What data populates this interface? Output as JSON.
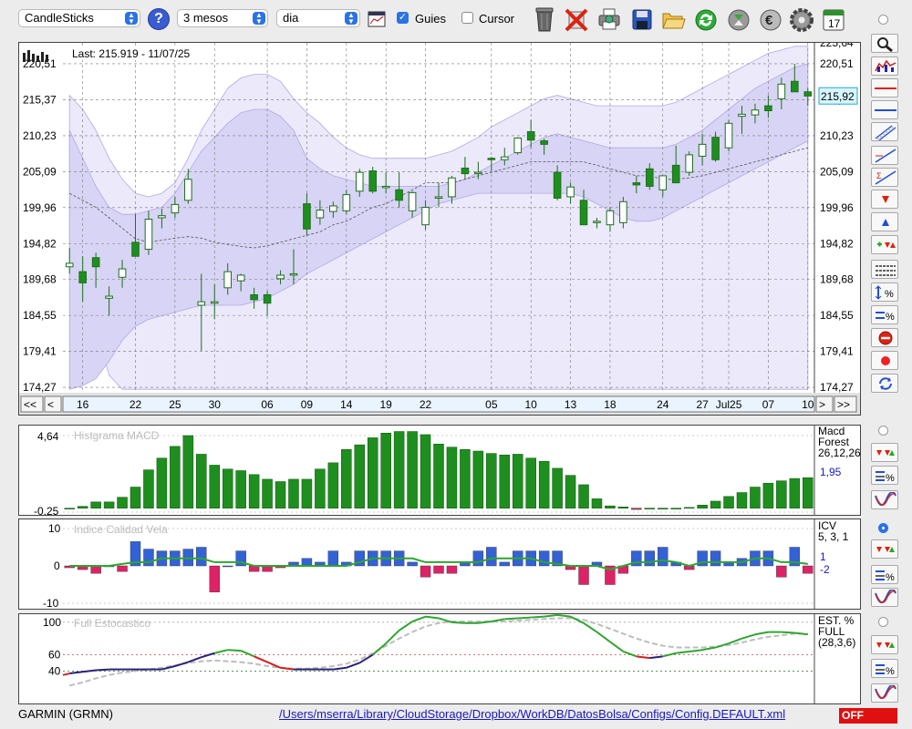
{
  "toolbar": {
    "chart_type": "CandleSticks",
    "period": "3 mesos",
    "interval": "dia",
    "guides_label": "Guies",
    "guides_checked": true,
    "cursor_label": "Cursor",
    "cursor_checked": false,
    "help_icon": "?",
    "icons": [
      "trash-icon",
      "delete-icon",
      "printer-icon",
      "save-icon",
      "open-folder-icon",
      "refresh-icon",
      "alert-icon",
      "euro-icon",
      "gear-icon",
      "calendar-icon"
    ]
  },
  "calendar_day": "17",
  "nav": {
    "first": "<<",
    "prev": "<",
    "next": ">",
    "last": ">>"
  },
  "colors": {
    "up": "#ffffff",
    "down": "#1e8f1e",
    "band": "#d8d4f5",
    "band_line": "#b1a8e6",
    "macd_bar": "#1e8f1e",
    "icv_up": "#3361d6",
    "icv_down": "#dd2266",
    "icv_line": "#2fa52f",
    "stoch_green": "#2fa52f",
    "stoch_navy": "#2b2077",
    "stoch_red": "#d02020",
    "stoch_gray": "#bdbdbd"
  },
  "chart_data": [
    {
      "type": "candlestick",
      "annotation": "Last: 215.919 - 11/07/25",
      "last_value_label": "215,92",
      "ylim": [
        173.5,
        223.5
      ],
      "yticks": [
        "174,27",
        "179,41",
        "184,55",
        "189,68",
        "194,82",
        "199,96",
        "205,09",
        "210,23",
        "215,37",
        "220,51",
        "225,64"
      ],
      "xticks": [
        {
          "i": 1,
          "label": "16"
        },
        {
          "i": 5,
          "label": "22"
        },
        {
          "i": 8,
          "label": "25"
        },
        {
          "i": 11,
          "label": "30"
        },
        {
          "i": 15,
          "label": "06"
        },
        {
          "i": 18,
          "label": "09"
        },
        {
          "i": 21,
          "label": "14"
        },
        {
          "i": 24,
          "label": "19"
        },
        {
          "i": 27,
          "label": "22"
        },
        {
          "i": 32,
          "label": "05"
        },
        {
          "i": 35,
          "label": "10"
        },
        {
          "i": 38,
          "label": "13"
        },
        {
          "i": 41,
          "label": "18"
        },
        {
          "i": 45,
          "label": "24"
        },
        {
          "i": 48,
          "label": "27"
        },
        {
          "i": 50,
          "label": "Jul25"
        },
        {
          "i": 53,
          "label": "07"
        },
        {
          "i": 56,
          "label": "10"
        }
      ],
      "candles": [
        [
          191.5,
          194.2,
          190.5,
          192.0
        ],
        [
          190.8,
          193.0,
          186.5,
          189.2
        ],
        [
          192.8,
          193.5,
          188.5,
          191.5
        ],
        [
          187.0,
          188.7,
          184.5,
          187.3
        ],
        [
          190.0,
          192.5,
          188.5,
          191.2
        ],
        [
          195.0,
          199.0,
          193.0,
          193.0
        ],
        [
          194.0,
          199.5,
          193.2,
          198.3
        ],
        [
          198.5,
          199.8,
          197.0,
          198.8
        ],
        [
          199.2,
          201.5,
          198.5,
          200.4
        ],
        [
          201.0,
          205.5,
          200.5,
          204.0
        ],
        [
          186.0,
          190.5,
          179.5,
          186.5
        ],
        [
          186.3,
          189.0,
          184.0,
          186.5
        ],
        [
          188.5,
          192.0,
          187.5,
          190.8
        ],
        [
          189.5,
          190.5,
          188.0,
          190.3
        ],
        [
          187.5,
          188.5,
          185.5,
          186.8
        ],
        [
          187.5,
          188.0,
          184.5,
          186.3
        ],
        [
          189.8,
          191.0,
          189.0,
          190.3
        ],
        [
          190.5,
          194.0,
          189.0,
          190.5
        ],
        [
          200.5,
          202.0,
          196.0,
          196.9
        ],
        [
          198.5,
          201.0,
          197.5,
          199.6
        ],
        [
          199.4,
          200.8,
          198.5,
          200.2
        ],
        [
          199.5,
          202.5,
          199.0,
          201.8
        ],
        [
          202.3,
          205.5,
          201.5,
          205.0
        ],
        [
          205.2,
          205.8,
          202.0,
          202.3
        ],
        [
          203.0,
          205.0,
          202.0,
          203.0
        ],
        [
          202.5,
          205.0,
          200.0,
          201.0
        ],
        [
          199.5,
          202.3,
          198.5,
          202.1
        ],
        [
          197.5,
          201.0,
          196.8,
          200.0
        ],
        [
          201.5,
          203.5,
          200.0,
          201.5
        ],
        [
          201.5,
          204.5,
          200.5,
          204.2
        ],
        [
          205.6,
          207.2,
          204.0,
          204.8
        ],
        [
          205.0,
          206.5,
          204.0,
          205.0
        ],
        [
          207.0,
          207.2,
          205.2,
          206.9
        ],
        [
          206.8,
          208.5,
          206.0,
          207.2
        ],
        [
          207.8,
          210.0,
          207.5,
          209.9
        ],
        [
          210.8,
          212.5,
          208.5,
          209.6
        ],
        [
          209.5,
          209.8,
          207.5,
          209.0
        ],
        [
          205.0,
          206.0,
          201.0,
          201.3
        ],
        [
          201.5,
          203.5,
          200.5,
          202.9
        ],
        [
          201.0,
          202.5,
          197.5,
          197.5
        ],
        [
          198.0,
          198.5,
          197.0,
          198.0
        ],
        [
          197.5,
          200.0,
          196.5,
          199.5
        ],
        [
          197.8,
          201.5,
          197.0,
          200.8
        ],
        [
          203.5,
          204.5,
          202.0,
          203.2
        ],
        [
          205.5,
          206.3,
          202.5,
          203.0
        ],
        [
          202.5,
          204.0,
          201.5,
          204.5
        ],
        [
          206.0,
          208.8,
          205.5,
          203.5
        ],
        [
          205.0,
          208.0,
          204.5,
          207.5
        ],
        [
          207.3,
          210.5,
          206.0,
          209.0
        ],
        [
          210.0,
          210.8,
          206.5,
          206.8
        ],
        [
          208.5,
          212.5,
          208.0,
          212.0
        ],
        [
          213.0,
          214.5,
          210.5,
          213.3
        ],
        [
          213.2,
          214.8,
          212.0,
          213.9
        ],
        [
          214.5,
          216.0,
          212.8,
          213.8
        ],
        [
          215.5,
          218.5,
          214.0,
          217.6
        ],
        [
          218.0,
          220.5,
          217.5,
          216.5
        ],
        [
          216.5,
          217.0,
          214.5,
          215.9
        ]
      ],
      "band_upper": [
        211,
        207,
        203,
        200,
        199,
        199,
        199.5,
        200,
        202,
        205,
        208,
        210,
        212,
        213.5,
        214,
        214,
        213,
        211,
        207,
        205.5,
        204.5,
        204,
        203.5,
        203,
        203,
        203,
        203,
        203,
        203,
        203.5,
        204,
        205,
        206,
        207,
        208,
        209,
        210,
        210.5,
        210,
        209.5,
        209,
        208.5,
        208.5,
        208.5,
        208.5,
        208.5,
        209,
        210,
        211,
        212.5,
        214,
        215.5,
        217,
        218,
        219,
        220,
        220.5
      ],
      "band_lower": [
        174,
        174.5,
        175.5,
        178,
        181,
        183,
        184,
        184.5,
        185,
        185.5,
        186,
        186,
        186,
        186,
        186.5,
        187,
        188,
        189,
        190.5,
        191.5,
        192.5,
        193.5,
        194.5,
        195.5,
        196.5,
        197.5,
        198.5,
        199.5,
        200.5,
        201,
        201.5,
        202,
        202,
        202,
        202,
        202,
        202,
        202,
        202,
        201.5,
        200.5,
        199.5,
        198.5,
        198,
        198,
        198.5,
        199.5,
        200.5,
        201.5,
        202.5,
        203.5,
        204.5,
        205.5,
        206.5,
        207.5,
        208.5,
        209.5
      ],
      "band_ma": [
        202,
        201,
        200,
        198.5,
        197,
        195.5,
        195,
        195.3,
        195.6,
        195.8,
        195.6,
        195,
        194.7,
        194.4,
        194.2,
        194.5,
        195,
        195.5,
        196,
        196.5,
        197.5,
        198,
        199,
        200,
        200.5,
        201.5,
        202.5,
        203.5,
        203.5,
        203.5,
        204,
        204.5,
        205,
        205.5,
        206,
        206.5,
        206.5,
        206.5,
        206.5,
        206.5,
        206,
        205.5,
        205,
        204.5,
        204.5,
        204,
        204,
        204.2,
        204.5,
        205,
        205.5,
        206,
        206.5,
        207,
        207.5,
        208,
        208.5
      ],
      "outer_upper": [
        216,
        214,
        211,
        207,
        204,
        202,
        201.5,
        202,
        203.5,
        207,
        211,
        214,
        217,
        218.5,
        219,
        219,
        218,
        215.5,
        213.5,
        212,
        210,
        208.5,
        207.5,
        207,
        207,
        207,
        207,
        207,
        207.5,
        208,
        209,
        210,
        211.5,
        212.5,
        213.5,
        214.5,
        215.5,
        216,
        215.5,
        215,
        214.5,
        214.5,
        214.5,
        214.5,
        214.5,
        214.5,
        215,
        216,
        217,
        218,
        219,
        220,
        221,
        222,
        222.5,
        223,
        223
      ],
      "outer_lower": [
        195,
        189,
        183,
        176,
        174,
        174,
        174,
        174,
        174,
        174,
        174,
        174,
        174,
        174,
        174,
        174,
        174,
        174,
        174,
        174,
        174,
        174,
        174,
        174,
        174,
        174,
        174,
        174,
        174,
        174,
        174,
        174,
        174,
        174,
        174,
        174,
        174,
        174,
        174,
        174,
        174,
        174,
        174,
        174,
        174,
        174,
        174,
        174,
        174,
        174,
        174,
        174,
        174,
        174,
        174,
        174,
        174
      ]
    },
    {
      "type": "bar",
      "title": "Histgrama MACD",
      "legend": [
        "Macd",
        "Forest",
        "26,12,26"
      ],
      "value_label": "1,95",
      "yticks": [
        "4,64",
        "-0,25"
      ],
      "ylim": [
        -0.25,
        4.64
      ],
      "values": [
        0.0,
        0.12,
        0.4,
        0.4,
        0.7,
        1.35,
        2.45,
        3.2,
        3.95,
        4.64,
        3.45,
        2.75,
        2.5,
        2.4,
        2.15,
        1.85,
        1.7,
        1.85,
        1.85,
        2.5,
        2.9,
        3.75,
        4.05,
        4.5,
        4.8,
        4.9,
        4.9,
        4.7,
        4.1,
        3.9,
        3.75,
        3.65,
        3.5,
        3.4,
        3.45,
        3.2,
        3.0,
        2.55,
        2.1,
        1.5,
        0.6,
        0.15,
        0.08,
        -0.08,
        0.0,
        0.0,
        0.0,
        0.05,
        0.2,
        0.45,
        0.75,
        1.0,
        1.35,
        1.6,
        1.75,
        1.9,
        1.95
      ]
    },
    {
      "type": "bar",
      "title": "Indice Calidad Vela",
      "legend": [
        "ICV",
        "5, 3, 1"
      ],
      "value_labels": [
        "1",
        "-2"
      ],
      "yticks": [
        "10",
        "0",
        "-10"
      ],
      "ylim": [
        -10,
        10
      ],
      "values": [
        -0.5,
        -1,
        -2,
        0,
        -1.5,
        6.5,
        4.5,
        4,
        4,
        4.5,
        5,
        -7,
        0,
        4,
        -1.5,
        -1.5,
        -0.5,
        1,
        2,
        1,
        4,
        1,
        4,
        4,
        4,
        4,
        1,
        -3,
        -2,
        -2,
        1,
        4,
        5,
        1,
        4,
        4,
        4,
        4,
        -1,
        -5,
        1,
        -5,
        -2,
        4,
        4,
        5,
        1,
        -1,
        4,
        4,
        1,
        2,
        4,
        4,
        -3,
        5,
        -2
      ],
      "line": [
        0,
        0,
        0,
        0,
        0.5,
        1,
        1,
        2,
        2,
        2,
        2,
        1,
        1,
        1,
        0,
        0,
        0,
        0,
        0,
        0,
        0,
        0,
        1,
        2,
        2,
        2,
        2,
        1,
        1,
        1,
        1,
        1,
        2,
        2,
        2,
        2,
        1,
        0.5,
        0,
        0,
        0,
        -1,
        0,
        1,
        1,
        1.5,
        1,
        0,
        1,
        1,
        1,
        1,
        2,
        2,
        1,
        1,
        0.5
      ]
    },
    {
      "type": "line",
      "title": "Full Estocastico",
      "legend": [
        "EST. %",
        "FULL",
        "(28,3,6)"
      ],
      "yticks": [
        "100",
        "60",
        "40"
      ],
      "ylim": [
        0,
        110
      ],
      "series": [
        {
          "role": "k",
          "values": [
            37,
            39,
            41,
            42,
            42,
            42,
            42,
            42,
            46,
            51,
            57,
            62,
            66,
            65,
            58,
            51,
            44,
            42,
            42,
            42,
            42,
            44,
            50,
            60,
            74,
            90,
            101,
            107,
            105,
            100,
            99,
            99,
            101,
            104,
            105,
            106,
            107,
            109,
            107,
            99,
            88,
            76,
            64,
            58,
            56,
            58,
            62,
            64,
            66,
            69,
            74,
            80,
            85,
            88,
            88,
            87,
            85
          ]
        },
        {
          "role": "d",
          "values": [
            22,
            26,
            31,
            35,
            38,
            40,
            42,
            44,
            47,
            50,
            52,
            53,
            52,
            51,
            49,
            46,
            44,
            43,
            43,
            44,
            46,
            49,
            54,
            62,
            71,
            80,
            88,
            95,
            99,
            101,
            101,
            101,
            101,
            101,
            102,
            103,
            104,
            105,
            105,
            103,
            98,
            92,
            86,
            80,
            75,
            71,
            69,
            69,
            69,
            70,
            72,
            75,
            79,
            82,
            84,
            86,
            86
          ]
        }
      ]
    }
  ],
  "status": {
    "symbol": "GARMIN (GRMN)",
    "path": "/Users/mserra/Library/CloudStorage/Dropbox/WorkDB/DatosBolsa/Configs/Config.DEFAULT.xml",
    "off_label": "OFF"
  }
}
